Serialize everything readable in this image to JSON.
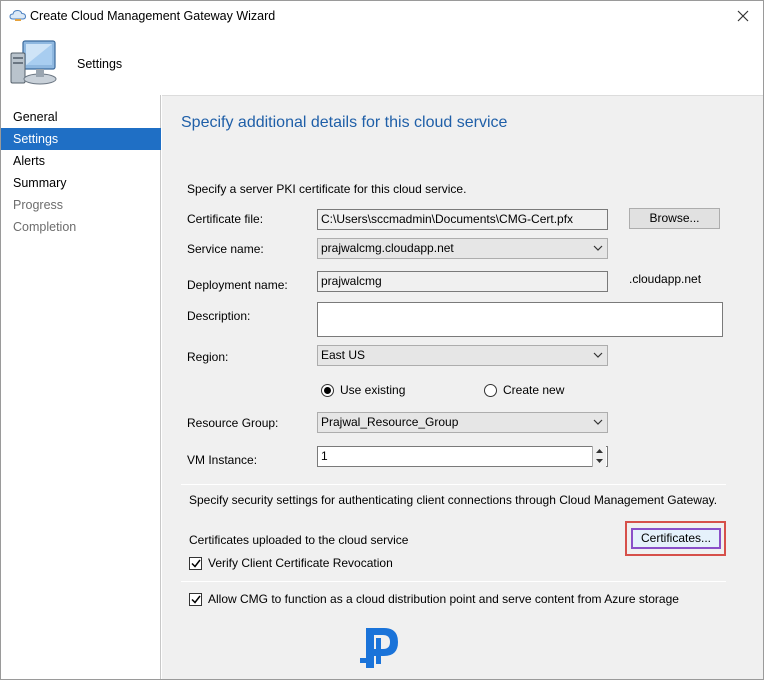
{
  "window": {
    "title": "Create Cloud Management Gateway Wizard"
  },
  "header": {
    "title": "Settings"
  },
  "nav": {
    "items": [
      {
        "label": "General",
        "state": "normal"
      },
      {
        "label": "Settings",
        "state": "selected"
      },
      {
        "label": "Alerts",
        "state": "normal"
      },
      {
        "label": "Summary",
        "state": "normal"
      },
      {
        "label": "Progress",
        "state": "dim"
      },
      {
        "label": "Completion",
        "state": "dim"
      }
    ]
  },
  "main": {
    "heading": "Specify additional details for this cloud service",
    "pki_intro": "Specify a server PKI certificate for this cloud service.",
    "certificate_file": {
      "label": "Certificate file:",
      "value": "C:\\Users\\sccmadmin\\Documents\\CMG-Cert.pfx",
      "browse_label": "Browse..."
    },
    "service_name": {
      "label": "Service name:",
      "value": "prajwalcmg.cloudapp.net"
    },
    "deployment_name": {
      "label": "Deployment name:",
      "value": "prajwalcmg",
      "suffix": ".cloudapp.net"
    },
    "description": {
      "label": "Description:",
      "value": ""
    },
    "region": {
      "label": "Region:",
      "value": "East US"
    },
    "resource_group_mode": {
      "use_existing": "Use existing",
      "create_new": "Create new",
      "selected": "use_existing"
    },
    "resource_group": {
      "label": "Resource Group:",
      "value": "Prajwal_Resource_Group"
    },
    "vm_instance": {
      "label": "VM Instance:",
      "value": "1"
    },
    "security_intro": "Specify security settings for authenticating client connections through Cloud Management Gateway.",
    "certificates": {
      "label": "Certificates uploaded to the cloud service",
      "button_label": "Certificates..."
    },
    "verify_revocation": {
      "label": "Verify Client Certificate Revocation",
      "checked": true
    },
    "allow_cdp": {
      "label": "Allow CMG to function as a cloud distribution point and serve content from Azure storage",
      "checked": true
    }
  },
  "colors": {
    "accent": "#1f6fc5",
    "heading": "#1f5fa8",
    "highlight": "#d6504a",
    "focus": "#8a4fc8",
    "logo": "#1a73d9"
  }
}
